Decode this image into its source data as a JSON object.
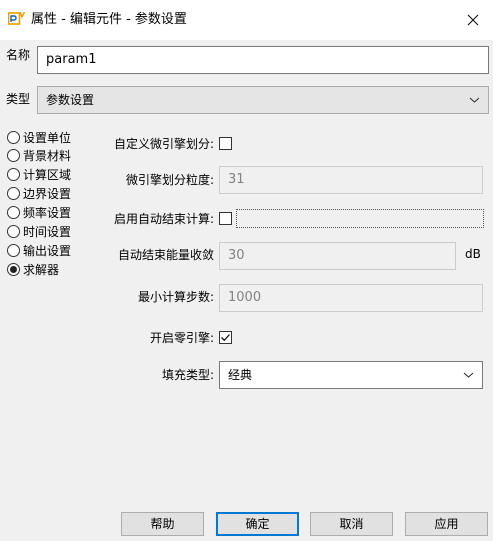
{
  "window": {
    "title": "属性 - 编辑元件 - 参数设置"
  },
  "icons": {
    "app": "app-icon",
    "close": "close-icon",
    "dropdown": "chevron-down-icon",
    "check": "checkmark-icon"
  },
  "colors": {
    "accent": "#0078d7",
    "brand_icon": "#e8a000"
  },
  "name_field": {
    "label": "名称",
    "value": "param1"
  },
  "type_field": {
    "label": "类型",
    "value": "参数设置"
  },
  "categories": [
    {
      "label": "设置单位",
      "selected": false
    },
    {
      "label": "背景材料",
      "selected": false
    },
    {
      "label": "计算区域",
      "selected": false
    },
    {
      "label": "边界设置",
      "selected": false
    },
    {
      "label": "频率设置",
      "selected": false
    },
    {
      "label": "时间设置",
      "selected": false
    },
    {
      "label": "输出设置",
      "selected": false
    },
    {
      "label": "求解器",
      "selected": true
    }
  ],
  "solver": {
    "custom_mesh": {
      "label": "自定义微引擎划分:",
      "checked": false
    },
    "mesh_granularity": {
      "label": "微引擎划分粒度:",
      "value": "31"
    },
    "auto_end": {
      "label": "启用自动结束计算:",
      "checked": false
    },
    "end_energy": {
      "label": "自动结束能量收敛",
      "value": "30",
      "unit": "dB"
    },
    "min_steps": {
      "label": "最小计算步数:",
      "value": "1000"
    },
    "zero_engine": {
      "label": "开启零引擎:",
      "checked": true
    },
    "fill_type": {
      "label": "填充类型:",
      "value": "经典"
    }
  },
  "buttons": {
    "help": "帮助",
    "ok": "确定",
    "cancel": "取消",
    "apply": "应用"
  }
}
